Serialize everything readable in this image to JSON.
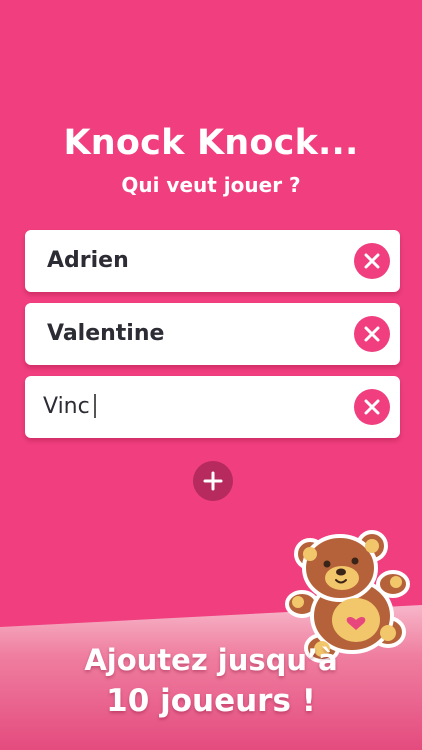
{
  "header": {
    "title": "Knock Knock...",
    "subtitle": "Qui veut jouer ?"
  },
  "players": [
    {
      "name": "Adrien",
      "remove_icon": "close-icon"
    },
    {
      "name": "Valentine",
      "remove_icon": "close-icon"
    }
  ],
  "input": {
    "value": "Vinc",
    "remove_icon": "close-icon"
  },
  "add_button": {
    "icon": "plus-icon"
  },
  "footer": {
    "line1": "Ajoutez jusqu’à",
    "line2": "10 joueurs !"
  },
  "mascot": {
    "icon": "teddy-bear-icon"
  },
  "colors": {
    "background": "#f03e7e",
    "card": "#ffffff",
    "text_dark": "#2c2c34",
    "add_button": "#b62a5e",
    "bear_brown": "#b5623a",
    "bear_light": "#f2c66b"
  }
}
